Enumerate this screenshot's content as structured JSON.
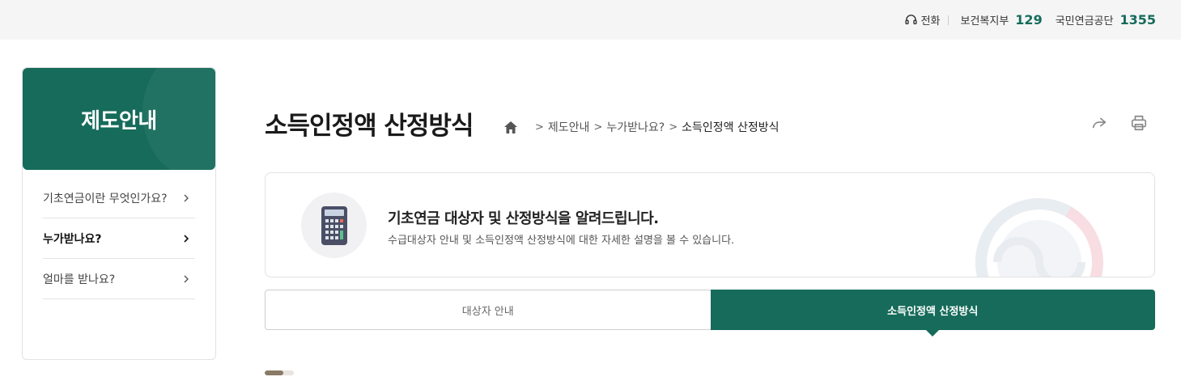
{
  "topbar": {
    "phone_label": "전화",
    "contacts": [
      {
        "org": "보건복지부",
        "number": "129"
      },
      {
        "org": "국민연금공단",
        "number": "1355"
      }
    ]
  },
  "sidebar": {
    "title": "제도안내",
    "items": [
      {
        "label": "기초연금이란 무엇인가요?",
        "active": false
      },
      {
        "label": "누가받나요?",
        "active": true
      },
      {
        "label": "얼마를 받나요?",
        "active": false
      }
    ]
  },
  "page": {
    "title": "소득인정액 산정방식",
    "breadcrumb": [
      "제도안내",
      "누가받나요?",
      "소득인정액 산정방식"
    ]
  },
  "info": {
    "heading": "기초연금 대상자 및 산정방식을 알려드립니다.",
    "description": "수급대상자 안내 및 소득인정액 산정방식에 대한 자세한 설명을 볼 수 있습니다."
  },
  "tabs": [
    {
      "label": "대상자 안내",
      "active": false
    },
    {
      "label": "소득인정액 산정방식",
      "active": true
    }
  ],
  "progress": {
    "value": 0.65
  },
  "colors": {
    "brand": "#166b5a",
    "topbar_bg": "#f5f5f6",
    "progress": "#8a7a66"
  },
  "icons": [
    "headset-icon",
    "home-icon",
    "share-icon",
    "print-icon",
    "calculator-icon",
    "chevron-right-icon"
  ]
}
